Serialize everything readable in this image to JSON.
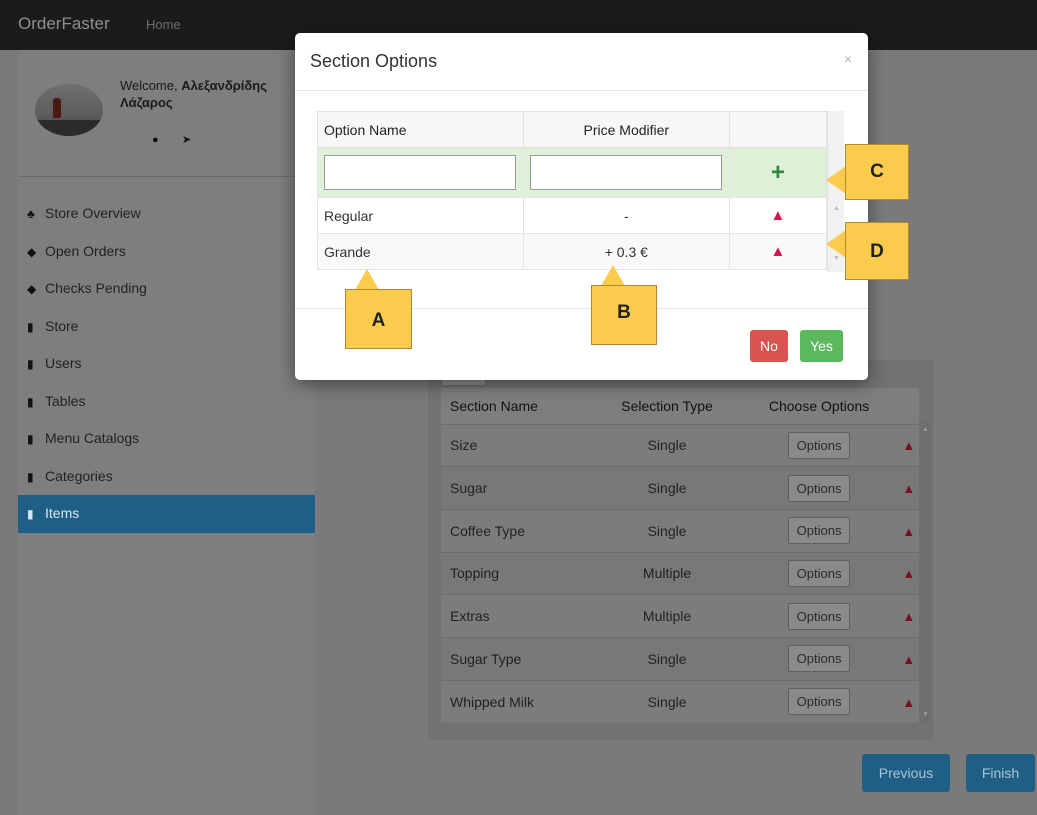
{
  "navbar": {
    "brand": "OrderFaster",
    "home": "Home"
  },
  "profile": {
    "welcome": "Welcome,",
    "surname": "Αλεξανδρίδης",
    "firstname": "Λάζαρος"
  },
  "sidebar": {
    "items": [
      {
        "label": "Store Overview",
        "icon": "sitemap-icon"
      },
      {
        "label": "Open Orders",
        "icon": "diamond-icon"
      },
      {
        "label": "Checks Pending",
        "icon": "diamond-icon"
      },
      {
        "label": "Store",
        "icon": "book-icon"
      },
      {
        "label": "Users",
        "icon": "book-icon"
      },
      {
        "label": "Tables",
        "icon": "book-icon"
      },
      {
        "label": "Menu Catalogs",
        "icon": "book-icon"
      },
      {
        "label": "Categories",
        "icon": "book-icon"
      },
      {
        "label": "Items",
        "icon": "book-icon",
        "active": true
      }
    ]
  },
  "sections": {
    "headers": [
      "Section Name",
      "Selection Type",
      "Choose Options"
    ],
    "options_label": "Options",
    "rows": [
      {
        "name": "Size",
        "type": "Single"
      },
      {
        "name": "Sugar",
        "type": "Single"
      },
      {
        "name": "Coffee Type",
        "type": "Single"
      },
      {
        "name": "Topping",
        "type": "Multiple"
      },
      {
        "name": "Extras",
        "type": "Multiple"
      },
      {
        "name": "Sugar Type",
        "type": "Single"
      },
      {
        "name": "Whipped Milk",
        "type": "Single"
      }
    ]
  },
  "footer": {
    "previous": "Previous",
    "finish": "Finish"
  },
  "modal": {
    "title": "Section Options",
    "close": "×",
    "headers": [
      "Option Name",
      "Price Modifier"
    ],
    "new_name": "",
    "new_price": "",
    "rows": [
      {
        "name": "Regular",
        "price": "-"
      },
      {
        "name": "Grande",
        "price": "+ 0.3 €"
      }
    ],
    "no": "No",
    "yes": "Yes"
  },
  "callouts": {
    "a": "A",
    "b": "B",
    "c": "C",
    "d": "D"
  },
  "colors": {
    "primary": "#1f5f86",
    "danger": "#d9534f",
    "success": "#5cb85c",
    "callout": "#fbcb4e"
  }
}
